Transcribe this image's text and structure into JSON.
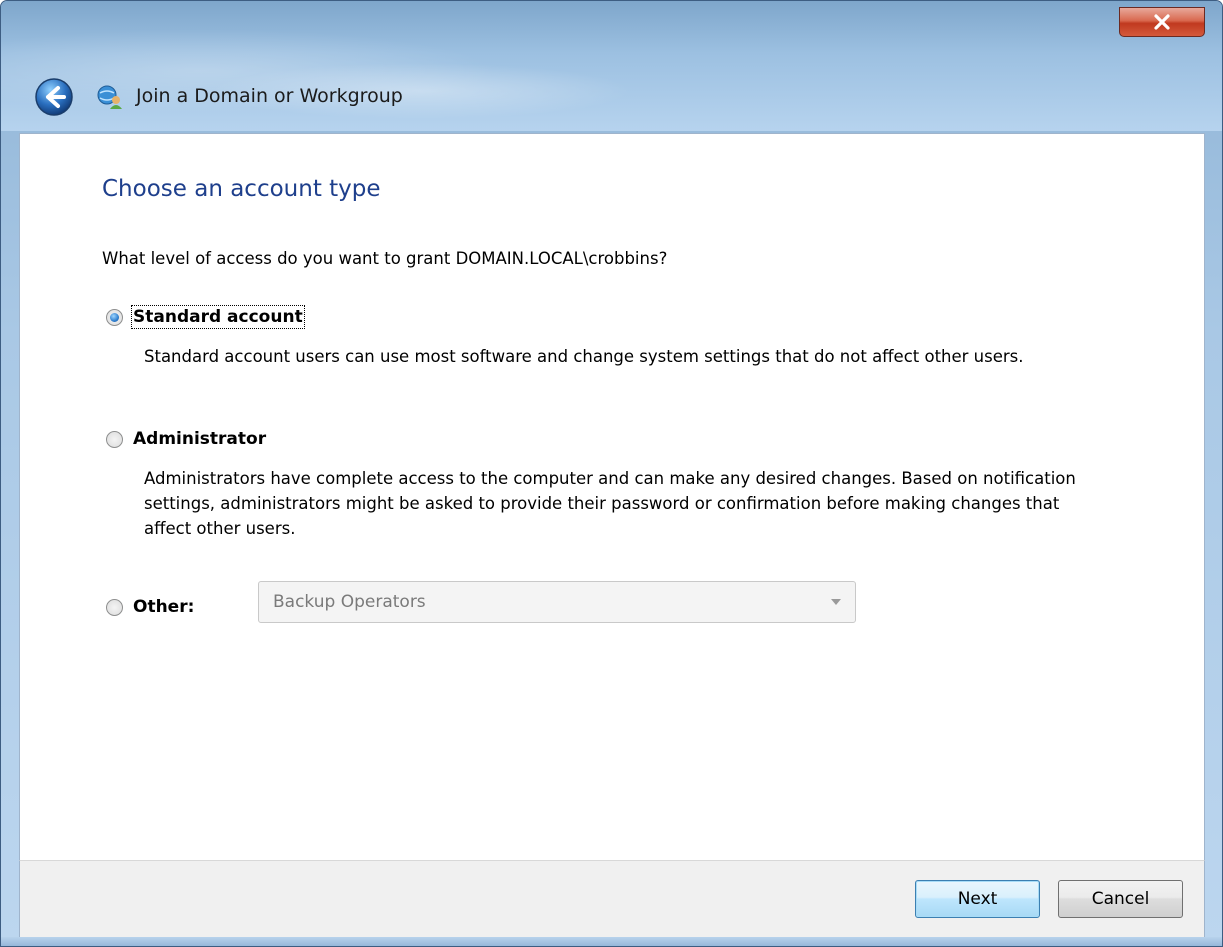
{
  "window": {
    "title": "Join a Domain or Workgroup",
    "close_glyph": "x"
  },
  "page": {
    "heading": "Choose an account type",
    "question": "What level of access do you want to grant DOMAIN.LOCAL\\crobbins?"
  },
  "options": [
    {
      "label": "Standard account",
      "checked": true,
      "description": "Standard account users can use most software and change system settings that do not affect other users."
    },
    {
      "label": "Administrator",
      "checked": false,
      "description": "Administrators have complete access to the computer and can make any desired changes. Based on notification settings, administrators might be asked to provide their password or confirmation before making changes that affect other users."
    },
    {
      "label": "Other:",
      "checked": false
    }
  ],
  "other_group_select": {
    "value": "Backup Operators",
    "enabled": false
  },
  "buttons": {
    "next": "Next",
    "cancel": "Cancel"
  },
  "colors": {
    "heading": "#1e3f8c",
    "close_button": "#c0391f"
  }
}
